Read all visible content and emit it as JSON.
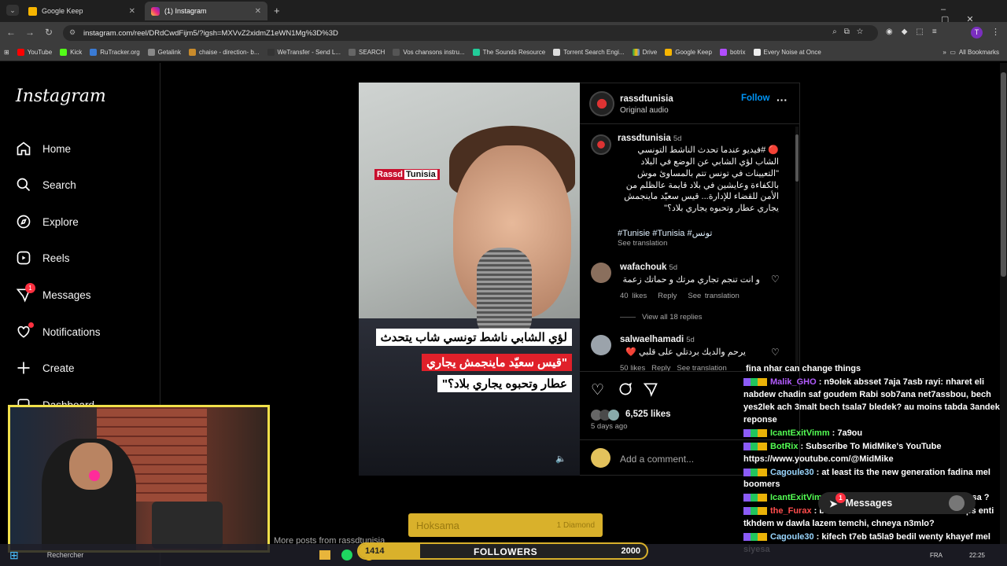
{
  "browser": {
    "tabs": [
      {
        "label": "Google Keep",
        "active": false
      },
      {
        "label": "(1) Instagram",
        "active": true
      }
    ],
    "url": "instagram.com/reel/DRdCwdFijm5/?igsh=MXVvZ2xidmZ1eWN1Mg%3D%3D",
    "bookmarks": [
      "YouTube",
      "Kick",
      "RuTracker.org",
      "Getalink",
      "chaise - direction- b...",
      "WeTransfer - Send L...",
      "SEARCH",
      "Vos chansons instru...",
      "The Sounds Resource",
      "Torrent Search Engi...",
      "Drive",
      "Google Keep",
      "botrix",
      "Every Noise at Once"
    ],
    "all_bookmarks": "All Bookmarks",
    "profile_letter": "T"
  },
  "instagram": {
    "logo": "Instagram",
    "nav": [
      {
        "label": "Home",
        "icon": "home-icon"
      },
      {
        "label": "Search",
        "icon": "search-icon"
      },
      {
        "label": "Explore",
        "icon": "explore-icon"
      },
      {
        "label": "Reels",
        "icon": "reels-icon"
      },
      {
        "label": "Messages",
        "icon": "messages-icon",
        "badge": "1"
      },
      {
        "label": "Notifications",
        "icon": "heart-icon"
      },
      {
        "label": "Create",
        "icon": "plus-icon"
      },
      {
        "label": "Dashboard",
        "icon": "dashboard-icon"
      }
    ],
    "video": {
      "logo_a": "Rassd",
      "logo_b": "Tunisia",
      "caption_1": "لؤي الشابي ناشط تونسي شاب يتحدث",
      "caption_2": "\"قيس سعيّد ماينجمش يجاري",
      "caption_3": "عطار وتحبوه يجاري بلاد؟\""
    },
    "post": {
      "username": "rassdtunisia",
      "audio": "Original audio",
      "follow": "Follow",
      "caption_user": "rassdtunisia",
      "caption_age": "5d",
      "caption_lines": [
        "🔴 #فيديو عندما تحدث الناشط التونسي",
        "الشاب لؤي الشابي عن الوضع في البلاد",
        "\"التعيينات في تونس تتم بالمساوئ موش",
        "بالكفاءة وعايشين في بلاد قايمة عالظلم من",
        "الأمن للقضاء للإدارة... قيس سعيّد ماينجمش",
        "يجاري عطار وتحبوه يجاري بلاد؟\""
      ],
      "hashtags": "#Tunisie #Tunisia #تونس",
      "see_translation": "See translation",
      "comments": [
        {
          "user": "wafachouk",
          "age": "5d",
          "text": "و انت تنجم تجاري مرتك و حماتك زعمة",
          "likes": "40 likes",
          "reply": "Reply",
          "translate": "See translation",
          "view_replies": "View all 18 replies"
        },
        {
          "user": "salwaelhamadi",
          "age": "5d",
          "text": "يرحم والديك بردتلي على قلبي ❤️",
          "likes": "50 likes",
          "reply": "Reply",
          "translate": "See translation"
        }
      ],
      "likes": "6,525 likes",
      "posted": "5 days ago",
      "add_comment": "Add a comment...",
      "more_posts": "More posts from rassdtunisia"
    },
    "messages_pill": {
      "label": "Messages",
      "badge": "1"
    }
  },
  "stream": {
    "chat": [
      {
        "user": "",
        "text": "fina nhar can change things",
        "color": "#ffffff"
      },
      {
        "user": "Malik_GHO",
        "text": ": n9olek absset 7aja 7asb rayi: nharet eli nabdew chadin saf goudem Rabi sob7ana net7assbou, bech yes2lek ach 3malt bech tsala7 bledek? au moins tabda 3andek reponse",
        "color": "#b35cff"
      },
      {
        "user": "IcantExitVimm",
        "text": ": 7a9ou",
        "color": "#54ff54"
      },
      {
        "user": "BotRix",
        "text": ": Subscribe To MidMike's YouTube https://www.youtube.com/@MidMike",
        "color": "#54ff54"
      },
      {
        "user": "Cagoule30",
        "text": ": at least its the new generation fadina mel boomers",
        "color": "#9ad7ff"
      },
      {
        "user": "IcantExitVimm",
        "text": ": kifeh nbadlou lbled menghir siessa ?",
        "color": "#54ff54"
      },
      {
        "user": "the_Furax",
        "text": ": behi don't trust them ama entre temps enti tkhdem w dawla lazem temchi, chneya n3mlo?",
        "color": "#ff4d4d"
      },
      {
        "user": "Cagoule30",
        "text": ": kifech t7eb ta5la9 bedil wenty khayef mel siyesa",
        "color": "#9ad7ff"
      }
    ],
    "goal_name": "Hoksama",
    "goal_type": "1 Diamond",
    "followers_label": "FOLLOWERS",
    "followers_current": 1414,
    "followers_target": 2000,
    "taskbar_search": "Rechercher",
    "clock": "22:25",
    "lang": "FRA"
  },
  "colors": {
    "accent": "#0095f6",
    "badge": "#ff3040",
    "goal": "#d9b12b",
    "cam_border": "#f1e04a"
  }
}
